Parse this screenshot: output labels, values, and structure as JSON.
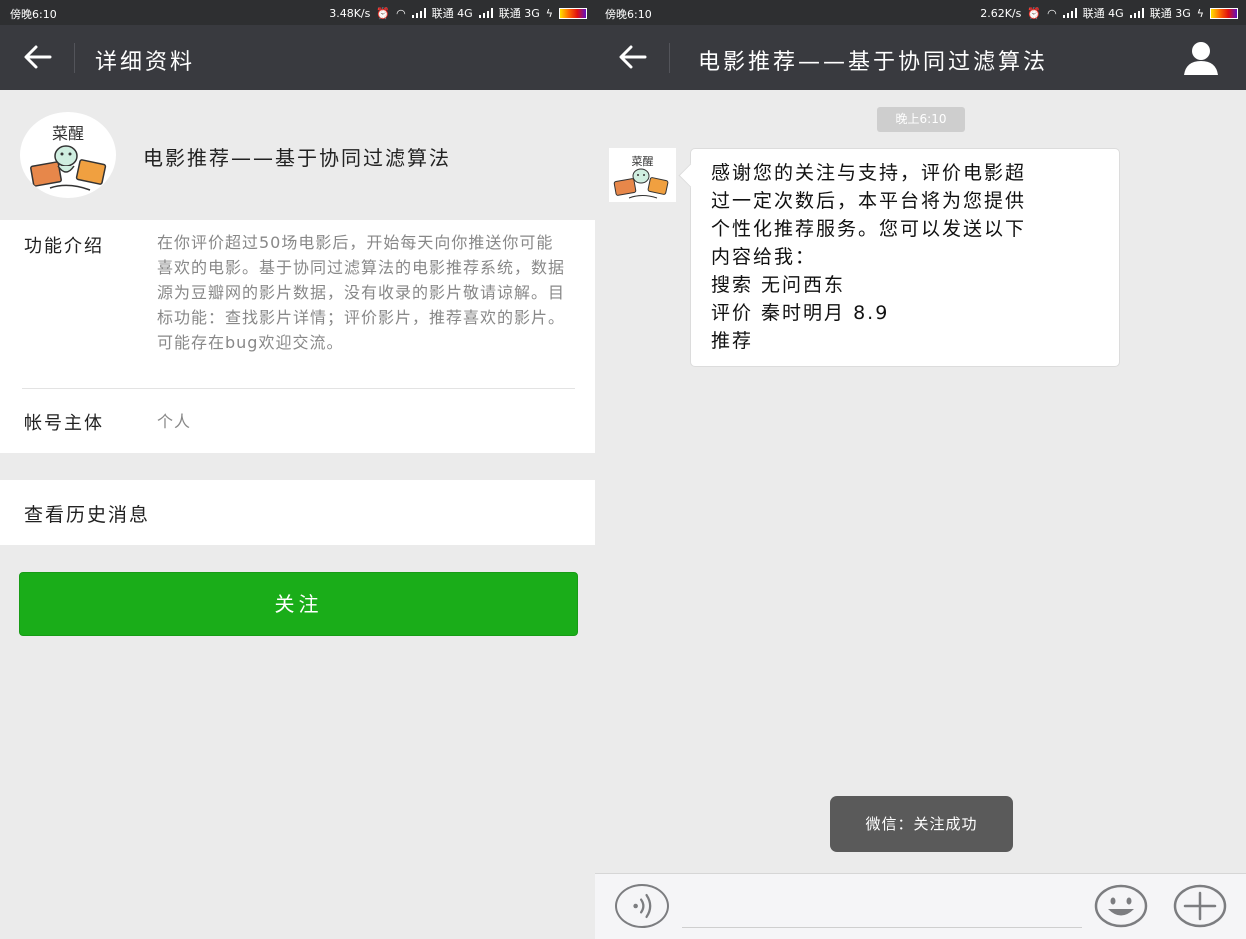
{
  "left": {
    "status": {
      "time": "傍晚6:10",
      "speed": "3.48K/s",
      "carrier1": "联通 4G",
      "carrier2": "联通 3G"
    },
    "title": "详细资料",
    "profile": {
      "avatar_text": "菜醒",
      "name": "电影推荐——基于协同过滤算法"
    },
    "intro": {
      "label": "功能介绍",
      "value": "在你评价超过50场电影后，开始每天向你推送你可能喜欢的电影。基于协同过滤算法的电影推荐系统，数据源为豆瓣网的影片数据，没有收录的影片敬请谅解。目标功能：查找影片详情；评价影片，推荐喜欢的影片。可能存在bug欢迎交流。"
    },
    "account": {
      "label": "帐号主体",
      "value": "个人"
    },
    "history_label": "查看历史消息",
    "follow_label": "关注"
  },
  "right": {
    "status": {
      "time": "傍晚6:10",
      "speed": "2.62K/s",
      "carrier1": "联通 4G",
      "carrier2": "联通 3G"
    },
    "title": "电影推荐——基于协同过滤算法",
    "timestamp": "晚上6:10",
    "avatar_text": "菜醒",
    "message_lines": [
      "感谢您的关注与支持，评价电影超",
      "过一定次数后，本平台将为您提供",
      "个性化推荐服务。您可以发送以下",
      "内容给我：",
      "搜索 无问西东",
      "评价 秦时明月 8.9",
      "推荐"
    ],
    "toast": "微信：关注成功",
    "input_placeholder": ""
  },
  "icons": {
    "back": "back-arrow-icon",
    "person": "person-icon",
    "voice": "voice-icon",
    "emoji": "emoji-icon",
    "plus": "plus-icon"
  },
  "colors": {
    "titlebar": "#393a3f",
    "statusbar": "#2e2f31",
    "follow_button": "#1aad19",
    "background": "#ebebeb"
  }
}
